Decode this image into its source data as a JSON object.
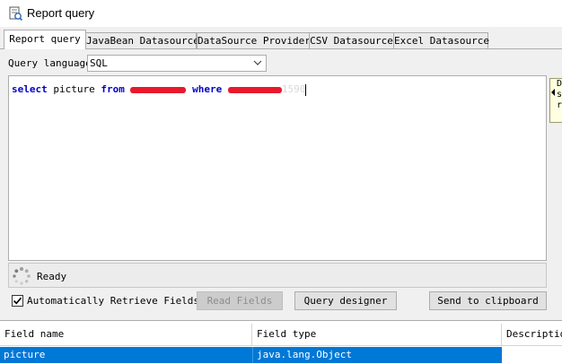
{
  "window": {
    "title": "Report query"
  },
  "tabs": [
    {
      "label": "Report query"
    },
    {
      "label": "JavaBean Datasource"
    },
    {
      "label": "DataSource Provider"
    },
    {
      "label": "CSV Datasource"
    },
    {
      "label": "Excel Datasource"
    }
  ],
  "query_language": {
    "label": "Query language",
    "value": "SQL"
  },
  "editor": {
    "kw_select": "select",
    "col": " picture ",
    "kw_from": "from",
    "kw_where": "where",
    "tail": "1590"
  },
  "side_note": {
    "lines": [
      "D",
      "s",
      "r"
    ]
  },
  "status": {
    "text": "Ready"
  },
  "options": {
    "auto_retrieve_label": "Automatically Retrieve Fields",
    "auto_retrieve_checked": true
  },
  "buttons": {
    "read_fields": "Read Fields",
    "query_designer": "Query designer",
    "send_to_clipboard": "Send to clipboard"
  },
  "fields_table": {
    "columns": [
      "Field name",
      "Field type",
      "Description"
    ],
    "rows": [
      {
        "name": "picture",
        "type": "java.lang.Object",
        "description": ""
      }
    ]
  }
}
